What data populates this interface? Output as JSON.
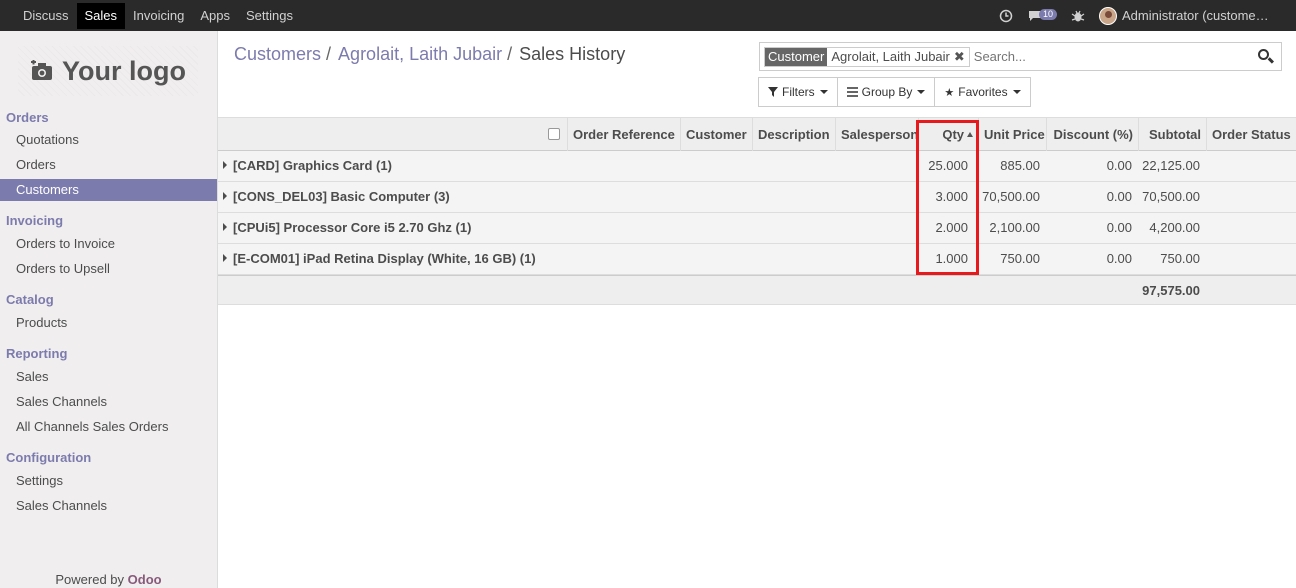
{
  "topbar": {
    "menu": [
      "Discuss",
      "Sales",
      "Invoicing",
      "Apps",
      "Settings"
    ],
    "active": "Sales",
    "icons": [
      "clock-icon",
      "chat-icon",
      "bug-icon"
    ],
    "message_count": "10",
    "user": "Administrator (customer...",
    "colors": {
      "bar": "#2a2a2a",
      "active": "#000000"
    }
  },
  "sidebar": {
    "logo_text": "Your logo",
    "sections": [
      {
        "title": "Orders",
        "items": [
          "Quotations",
          "Orders",
          "Customers"
        ]
      },
      {
        "title": "Invoicing",
        "items": [
          "Orders to Invoice",
          "Orders to Upsell"
        ]
      },
      {
        "title": "Catalog",
        "items": [
          "Products"
        ]
      },
      {
        "title": "Reporting",
        "items": [
          "Sales",
          "Sales Channels",
          "All Channels Sales Orders"
        ]
      },
      {
        "title": "Configuration",
        "items": [
          "Settings",
          "Sales Channels"
        ]
      }
    ],
    "active_item": "Customers",
    "powered_prefix": "Powered by",
    "powered_brand": "Odoo",
    "accent": "#7c7bad"
  },
  "breadcrumb": {
    "items": [
      "Customers",
      "Agrolait, Laith Jubair"
    ],
    "current": "Sales History"
  },
  "search": {
    "facet_label": "Customer",
    "facet_value": "Agrolait, Laith Jubair",
    "placeholder": "Search..."
  },
  "buttons": {
    "filters": "Filters",
    "group_by": "Group By",
    "favorites": "Favorites"
  },
  "table": {
    "columns": [
      "Order Reference",
      "Customer",
      "Description",
      "Salesperson",
      "Qty",
      "Unit Price",
      "Discount (%)",
      "Subtotal",
      "Order Status"
    ],
    "sorted_column": "Qty",
    "groups": [
      {
        "name": "[CARD] Graphics Card (1)",
        "qty": "25.000",
        "unit_price": "885.00",
        "discount": "0.00",
        "subtotal": "22,125.00"
      },
      {
        "name": "[CONS_DEL03] Basic Computer (3)",
        "qty": "3.000",
        "unit_price": "70,500.00",
        "discount": "0.00",
        "subtotal": "70,500.00"
      },
      {
        "name": "[CPUi5] Processor Core i5 2.70 Ghz (1)",
        "qty": "2.000",
        "unit_price": "2,100.00",
        "discount": "0.00",
        "subtotal": "4,200.00"
      },
      {
        "name": "[E-COM01] iPad Retina Display (White, 16 GB) (1)",
        "qty": "1.000",
        "unit_price": "750.00",
        "discount": "0.00",
        "subtotal": "750.00"
      }
    ],
    "total_subtotal": "97,575.00",
    "highlight_color": "#e8191d"
  }
}
